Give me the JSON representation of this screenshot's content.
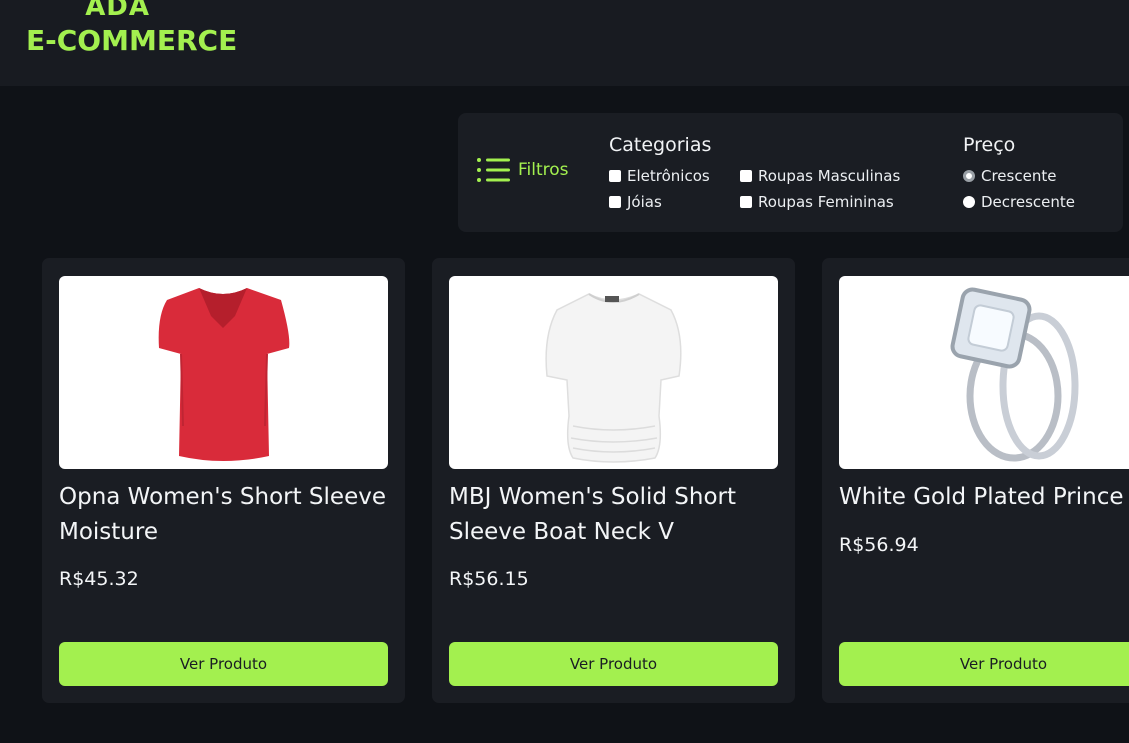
{
  "header": {
    "logo_line1": "ADA",
    "logo_line2": "E-COMMERCE"
  },
  "filters": {
    "toggle_label": "Filtros",
    "categories_title": "Categorias",
    "categories": [
      {
        "label": "Eletrônicos",
        "checked": false
      },
      {
        "label": "Roupas Masculinas",
        "checked": false
      },
      {
        "label": "Jóias",
        "checked": false
      },
      {
        "label": "Roupas Femininas",
        "checked": false
      }
    ],
    "price_title": "Preço",
    "price_options": [
      {
        "label": "Crescente",
        "selected": true
      },
      {
        "label": "Decrescente",
        "selected": false
      }
    ]
  },
  "products": [
    {
      "title": "Opna Women's Short Sleeve Moisture",
      "price": "R$45.32",
      "button": "Ver Produto",
      "image": "red-tshirt"
    },
    {
      "title": "MBJ Women's Solid Short Sleeve Boat Neck V",
      "price": "R$56.15",
      "button": "Ver Produto",
      "image": "white-top"
    },
    {
      "title": "White Gold Plated Prince",
      "price": "R$56.94",
      "button": "Ver Produto",
      "image": "ring"
    }
  ],
  "colors": {
    "accent": "#a3f04f",
    "background": "#0f1217",
    "card": "#1a1d23"
  }
}
